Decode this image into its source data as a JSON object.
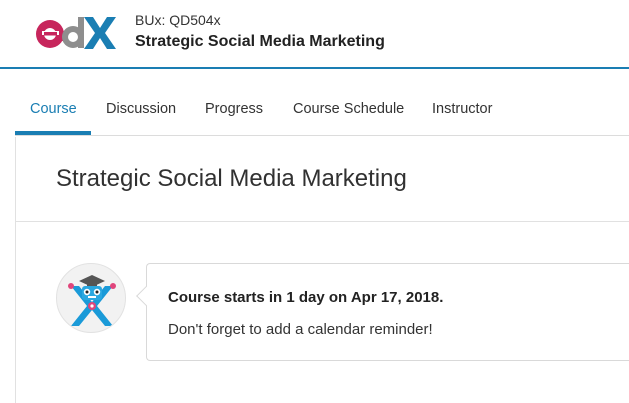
{
  "header": {
    "logo_text": "edX",
    "course_org": "BUx: QD504x",
    "course_name": "Strategic Social Media Marketing",
    "colors": {
      "accent": "#1a7eb3",
      "logo_pink": "#c7265c",
      "logo_gray": "#8e8e8e",
      "logo_blue": "#1a7eb3"
    }
  },
  "tabs": [
    {
      "label": "Course",
      "active": true
    },
    {
      "label": "Discussion",
      "active": false
    },
    {
      "label": "Progress",
      "active": false
    },
    {
      "label": "Course Schedule",
      "active": false
    },
    {
      "label": "Instructor",
      "active": false
    }
  ],
  "main": {
    "page_title": "Strategic Social Media Marketing",
    "message": {
      "avatar_icon": "edx-robot-mascot-icon",
      "title": "Course starts in 1 day on Apr 17, 2018.",
      "body": "Don't forget to add a calendar reminder!"
    }
  }
}
